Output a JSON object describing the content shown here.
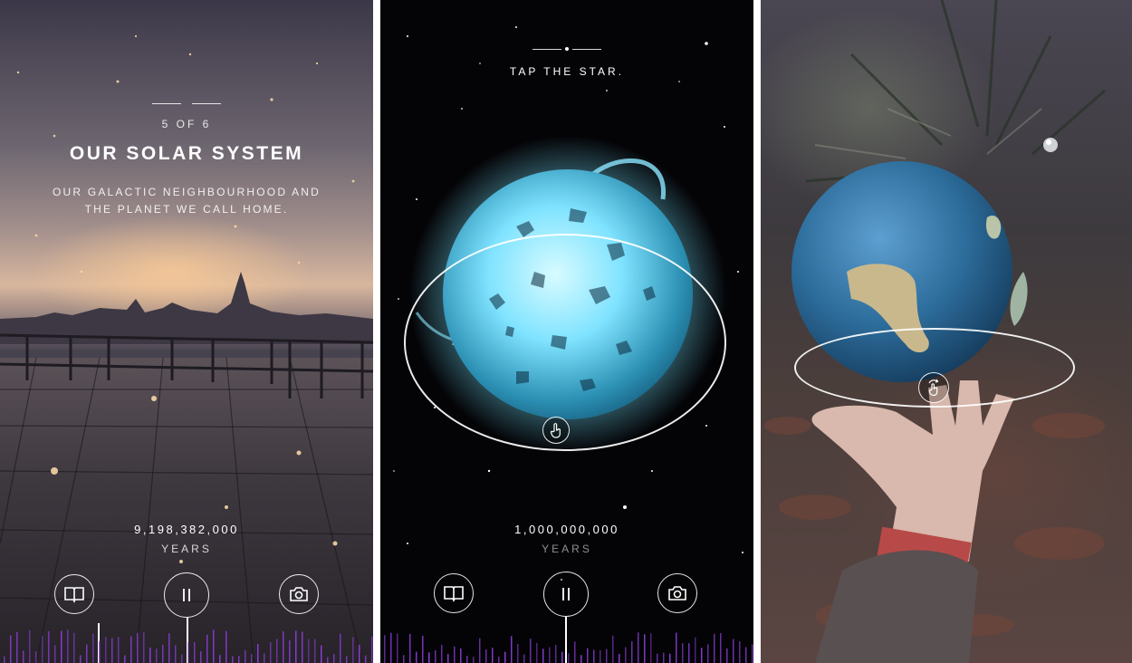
{
  "screens": [
    {
      "step": "5 OF 6",
      "title": "OUR SOLAR SYSTEM",
      "subtitle_line1": "OUR GALACTIC NEIGHBOURHOOD AND",
      "subtitle_line2": "THE PLANET WE CALL HOME.",
      "counter_value": "9,198,382,000",
      "counter_unit": "YEARS",
      "controls": {
        "left": "book-icon",
        "center": "pause-icon",
        "right": "camera-icon"
      }
    },
    {
      "instruction": "TAP THE STAR.",
      "counter_value": "1,000,000,000",
      "counter_unit": "YEARS",
      "star_color": "#7fe3ff",
      "controls": {
        "left": "book-icon",
        "center": "pause-icon",
        "right": "camera-icon"
      },
      "hint_icon": "tap-hand-icon"
    },
    {
      "planet": "earth",
      "hint_icon": "rotate-hand-icon"
    }
  ],
  "colors": {
    "timeline_bars": "#8a3dd6",
    "accent_white": "#ffffff"
  }
}
